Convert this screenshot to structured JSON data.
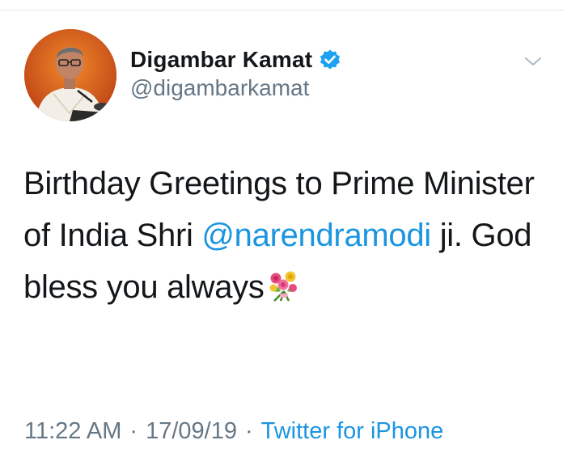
{
  "user": {
    "display_name": "Digambar Kamat",
    "handle": "@digambarkamat",
    "verified_icon": "verified-badge-icon",
    "avatar": "profile-photo"
  },
  "tweet": {
    "text_part1": "Birthday Greetings to Prime Minister of India Shri ",
    "mention": "@narendramodi",
    "text_part2": " ji. God bless you always",
    "emoji": "bouquet-icon"
  },
  "meta": {
    "time": "11:22 AM",
    "separator": "·",
    "date": "17/09/19",
    "source": "Twitter for iPhone"
  },
  "colors": {
    "link": "#1b95e0",
    "secondary_text": "#657786",
    "primary_text": "#14171a",
    "verified": "#1da1f2"
  }
}
